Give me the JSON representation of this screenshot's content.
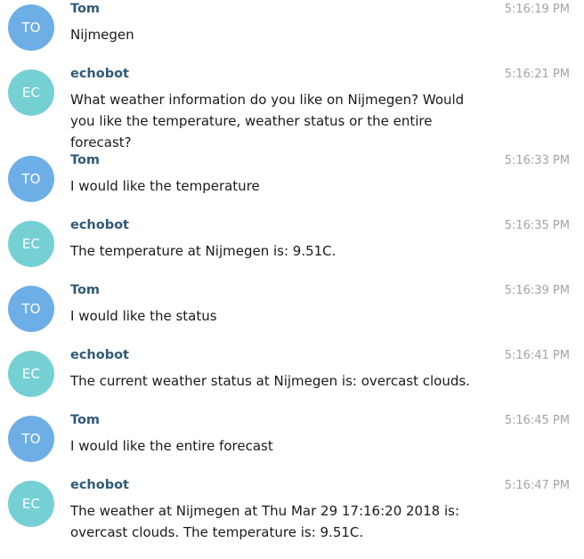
{
  "messages": [
    {
      "initials": "TO",
      "sender": "Tom",
      "time": "5:16:19 PM",
      "text": "Nijmegen",
      "kind": "tom"
    },
    {
      "initials": "EC",
      "sender": "echobot",
      "time": "5:16:21 PM",
      "text": "What weather information do you like on Nijmegen? Would you like the temperature, weather status or the entire forecast?",
      "kind": "bot"
    },
    {
      "initials": "TO",
      "sender": "Tom",
      "time": "5:16:33 PM",
      "text": "I would like the temperature",
      "kind": "tom"
    },
    {
      "initials": "EC",
      "sender": "echobot",
      "time": "5:16:35 PM",
      "text": "The temperature at Nijmegen is: 9.51C.",
      "kind": "bot"
    },
    {
      "initials": "TO",
      "sender": "Tom",
      "time": "5:16:39 PM",
      "text": "I would like the status",
      "kind": "tom"
    },
    {
      "initials": "EC",
      "sender": "echobot",
      "time": "5:16:41 PM",
      "text": "The current weather status at Nijmegen is: overcast clouds.",
      "kind": "bot"
    },
    {
      "initials": "TO",
      "sender": "Tom",
      "time": "5:16:45 PM",
      "text": "I would like the entire forecast",
      "kind": "tom"
    },
    {
      "initials": "EC",
      "sender": "echobot",
      "time": "5:16:47 PM",
      "text": "The weather at Nijmegen at Thu Mar 29 17:16:20 2018 is: overcast clouds. The temperature is: 9.51C.",
      "kind": "bot"
    }
  ],
  "colors": {
    "tom_avatar": "#6eaee6",
    "bot_avatar": "#75d0d3",
    "sender_name": "#2f5a78",
    "timestamp": "#a3a3a3"
  }
}
